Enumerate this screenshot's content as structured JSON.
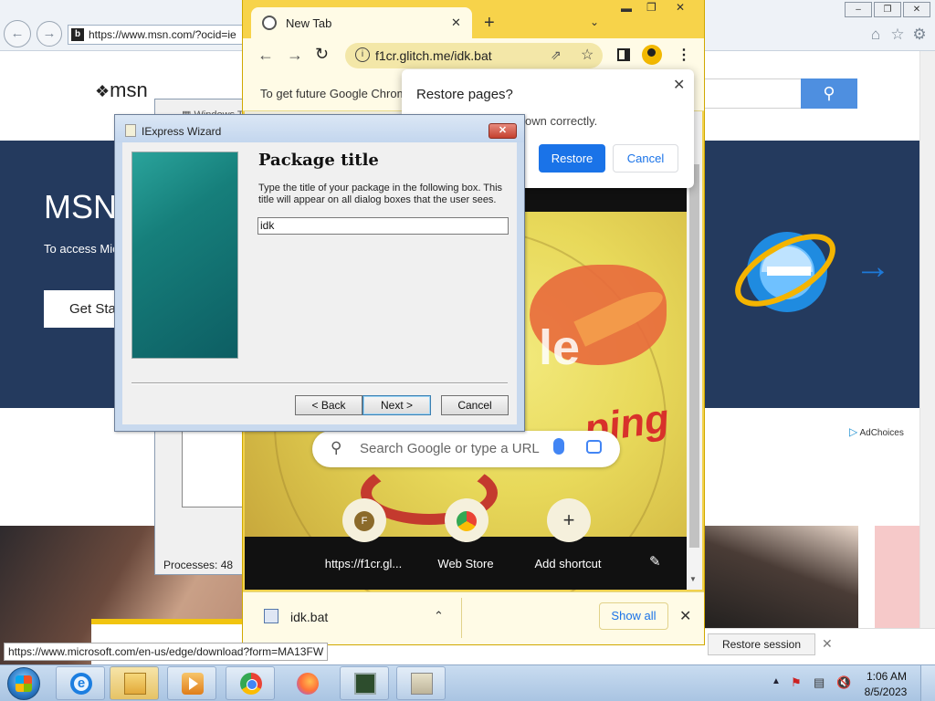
{
  "ie": {
    "address": "https://www.msn.com/?ocid=ie",
    "msn_logo": "msn",
    "hero_title": "MSN",
    "hero_subtitle": "To access Mic",
    "get_started": "Get Sta",
    "adchoices": "AdChoices",
    "restore_session": "Restore session",
    "status_url": "https://www.microsoft.com/en-us/edge/download?form=MA13FW",
    "icons": [
      "back-icon",
      "forward-icon",
      "home-icon",
      "star-icon",
      "gear-icon",
      "search-icon"
    ]
  },
  "taskmgr": {
    "title": "Windows Ta",
    "processes": "Processes: 48"
  },
  "chrome": {
    "tab_title": "New Tab",
    "url": "f1cr.glitch.me/idk.bat",
    "infobar_text": "To get future Google Chrom",
    "search_placeholder": "Search Google or type a URL",
    "shortcuts": [
      {
        "label": "https://f1cr.gl...",
        "glyph": "F"
      },
      {
        "label": "Web Store",
        "glyph": ""
      },
      {
        "label": "Add shortcut",
        "glyph": "+"
      }
    ],
    "doodle_text1": "le",
    "doodle_text2": "ping",
    "download": {
      "file": "idk.bat",
      "show_all": "Show all"
    },
    "restore_popup": {
      "title": "Restore pages?",
      "body": "own correctly.",
      "restore": "Restore",
      "cancel": "Cancel"
    }
  },
  "wizard": {
    "title": "IExpress Wizard",
    "heading": "Package title",
    "description": "Type the title of your package in the following  box.  This title will appear on all dialog boxes that the user sees.",
    "input_value": "idk",
    "back": "< Back",
    "next": "Next >",
    "cancel": "Cancel"
  },
  "taskbar": {
    "time": "1:06 AM",
    "date": "8/5/2023",
    "apps": [
      "internet-explorer",
      "windows-explorer",
      "media-player",
      "google-chrome",
      "firefox",
      "task-manager",
      "iexpress"
    ]
  },
  "colors": {
    "chrome_theme": "#f2d24c",
    "msn_hero": "#243a5e",
    "accent_blue": "#1a73e8",
    "wizard_banner": "#167f7b"
  }
}
